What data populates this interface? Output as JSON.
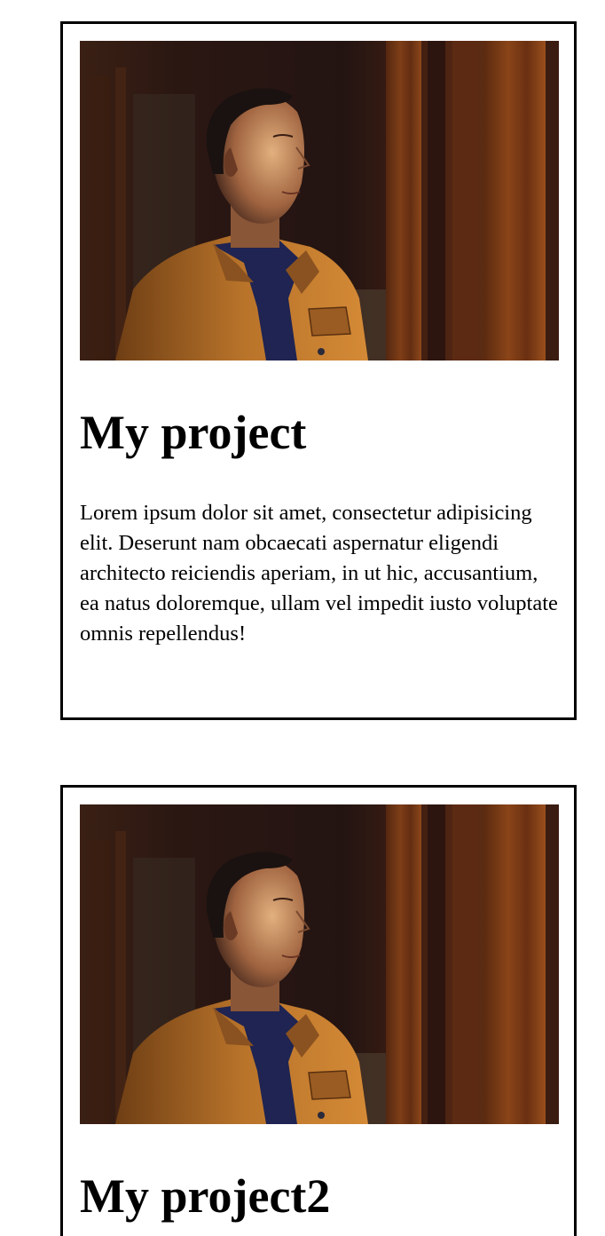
{
  "projects": [
    {
      "image_alt": "Portrait of a man in an orange jacket looking up",
      "title": "My project",
      "description": "Lorem ipsum dolor sit amet, consectetur adipisicing elit. Deserunt nam obcaecati aspernatur eligendi architecto reiciendis aperiam, in ut hic, accusantium, ea natus doloremque, ullam vel impedit iusto voluptate omnis repellendus!"
    },
    {
      "image_alt": "Portrait of a man in an orange jacket looking up",
      "title": "My project2",
      "description": ""
    }
  ],
  "colors": {
    "border": "#000000",
    "jacket": "#b8732a",
    "shirt": "#1f2452",
    "background_dark": "#2a1610",
    "wood": "#7a3d18"
  }
}
